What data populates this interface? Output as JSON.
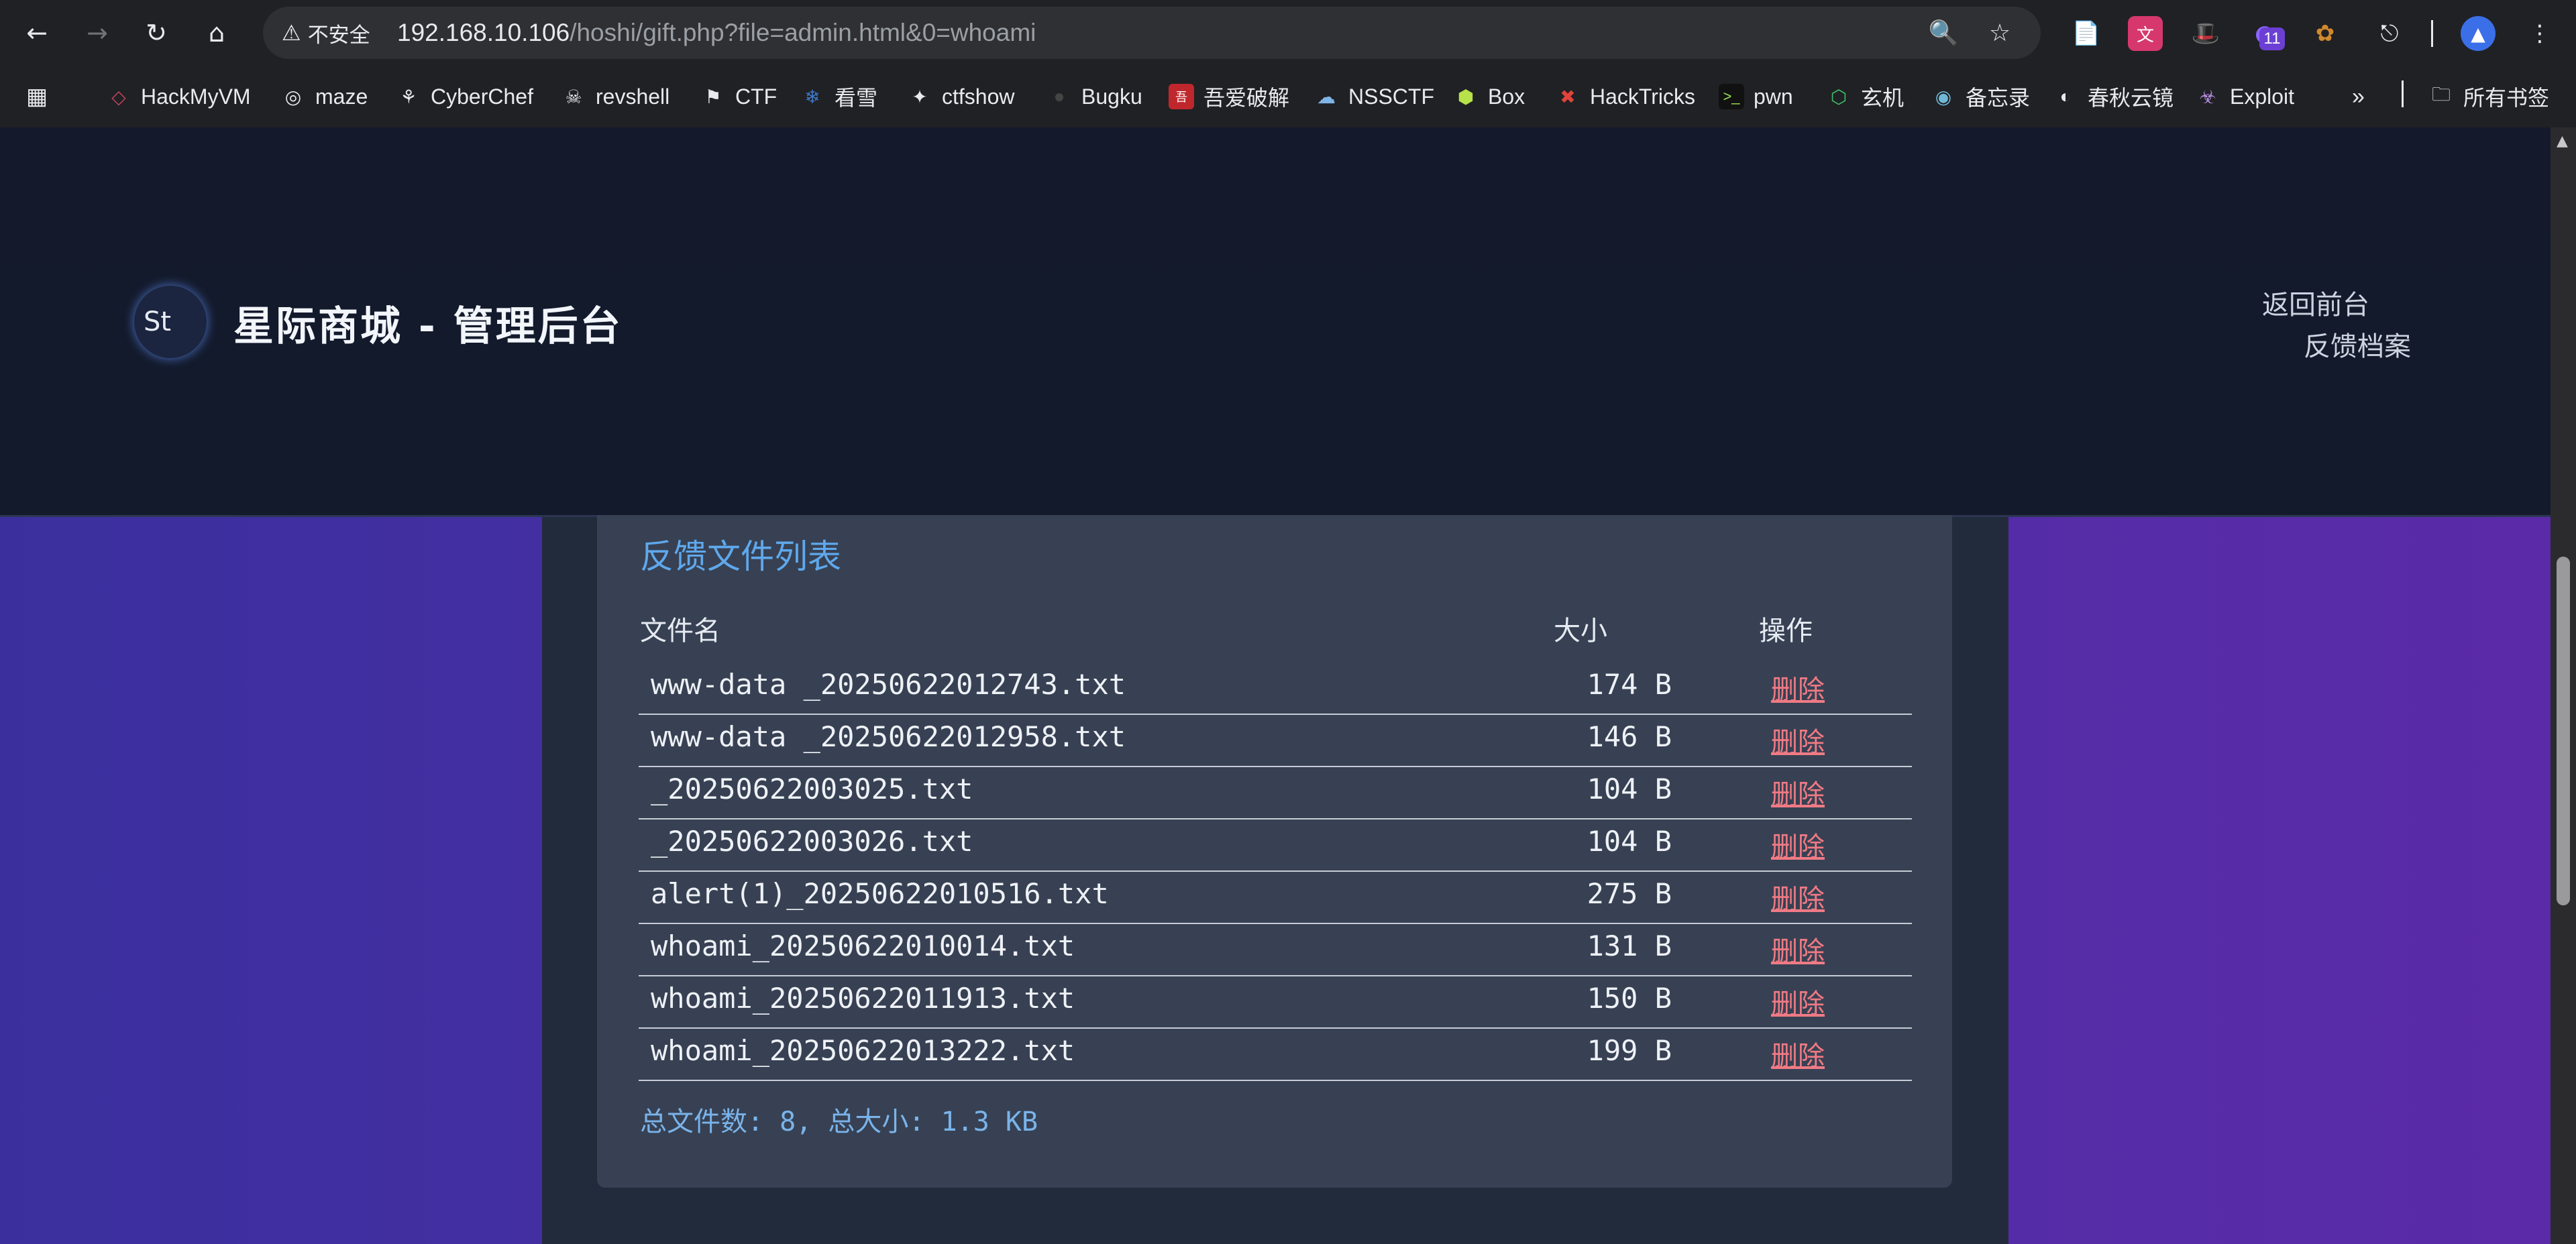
{
  "browser": {
    "security_label": "不安全",
    "url_host": "192.168.10.106",
    "url_path": "/hoshi/gift.php?file=admin.html&0=whoami",
    "extension_badge": "11"
  },
  "bookmarks": {
    "items": [
      {
        "label": "HackMyVM",
        "icon": "diamond-icon"
      },
      {
        "label": "maze",
        "icon": "maze-icon"
      },
      {
        "label": "CyberChef",
        "icon": "chef-icon"
      },
      {
        "label": "revshell",
        "icon": "skull-icon"
      },
      {
        "label": "CTF",
        "icon": "flag-icon"
      },
      {
        "label": "看雪",
        "icon": "snow-icon"
      },
      {
        "label": "ctfshow",
        "icon": "runner-icon"
      },
      {
        "label": "Bugku",
        "icon": "bug-icon"
      },
      {
        "label": "吾爱破解",
        "icon": "seal-icon"
      },
      {
        "label": "NSSCTF",
        "icon": "cloud-icon"
      },
      {
        "label": "Box",
        "icon": "cube-icon"
      },
      {
        "label": "HackTricks",
        "icon": "tricks-icon"
      },
      {
        "label": "pwn",
        "icon": "terminal-icon"
      },
      {
        "label": "玄机",
        "icon": "hexagon-icon"
      },
      {
        "label": "备忘录",
        "icon": "memo-icon"
      },
      {
        "label": "春秋云镜",
        "icon": "mirror-icon"
      },
      {
        "label": "Exploit",
        "icon": "exploit-icon"
      }
    ],
    "all_bookmarks": "所有书签"
  },
  "header": {
    "logo_alt": "St",
    "title": "星际商城 - 管理后台",
    "nav": {
      "back_to_front": "返回前台",
      "feedback_archive": "反馈档案"
    }
  },
  "panel": {
    "title": "反馈文件列表",
    "columns": {
      "name": "文件名",
      "size": "大小",
      "action": "操作"
    },
    "rows": [
      {
        "name": "www-data _20250622012743.txt",
        "size": "174 B",
        "action": "删除"
      },
      {
        "name": "www-data _20250622012958.txt",
        "size": "146 B",
        "action": "删除"
      },
      {
        "name": "_20250622003025.txt",
        "size": "104 B",
        "action": "删除"
      },
      {
        "name": "_20250622003026.txt",
        "size": "104 B",
        "action": "删除"
      },
      {
        "name": "alert(1)_20250622010516.txt",
        "size": "275 B",
        "action": "删除"
      },
      {
        "name": "whoami_20250622010014.txt",
        "size": "131 B",
        "action": "删除"
      },
      {
        "name": "whoami_20250622011913.txt",
        "size": "150 B",
        "action": "删除"
      },
      {
        "name": "whoami_20250622013222.txt",
        "size": "199 B",
        "action": "删除"
      }
    ],
    "summary": "总文件数: 8, 总大小: 1.3 KB"
  },
  "colors": {
    "header_bg": "#141a2c",
    "panel_bg": "#374153",
    "title_blue": "#5fa8ec",
    "delete_red": "#f07a84",
    "page_gradient_left": "#3b2f9e",
    "page_gradient_right": "#5a2aa8"
  }
}
